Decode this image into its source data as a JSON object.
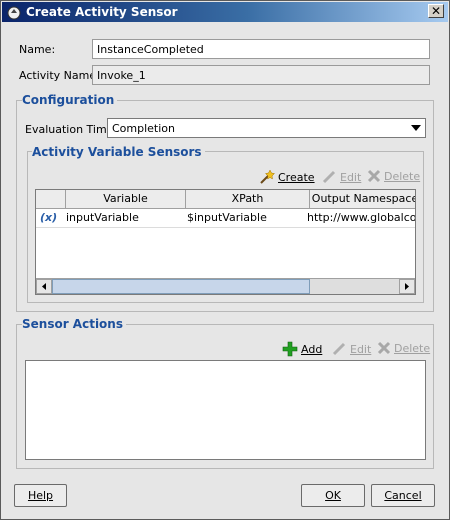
{
  "dialog": {
    "title": "Create Activity Sensor",
    "close_label": "✕"
  },
  "form": {
    "name_label": "Name:",
    "name_value": "InstanceCompleted",
    "activity_name_label": "Activity Name:",
    "activity_name_value": "Invoke_1"
  },
  "configuration": {
    "title": "Configuration",
    "evaluation_time_label": "Evaluation Time:",
    "evaluation_time_value": "Completion"
  },
  "variable_sensors": {
    "title": "Activity Variable Sensors",
    "create_label": "Create",
    "edit_label": "Edit",
    "delete_label": "Delete",
    "columns": [
      "",
      "Variable",
      "XPath",
      "Output Namespace"
    ],
    "rows": [
      {
        "icon": "(x)",
        "variable": "inputVariable",
        "xpath": "$inputVariable",
        "namespace": "http://www.globalcom"
      }
    ]
  },
  "sensor_actions": {
    "title": "Sensor Actions",
    "add_label": "Add",
    "edit_label": "Edit",
    "delete_label": "Delete"
  },
  "footer": {
    "help_label": "Help",
    "ok_label": "OK",
    "cancel_label": "Cancel"
  },
  "colors": {
    "title_bar": "#0a246a",
    "group_title": "#1c4f9c",
    "add_icon": "#22a022"
  }
}
